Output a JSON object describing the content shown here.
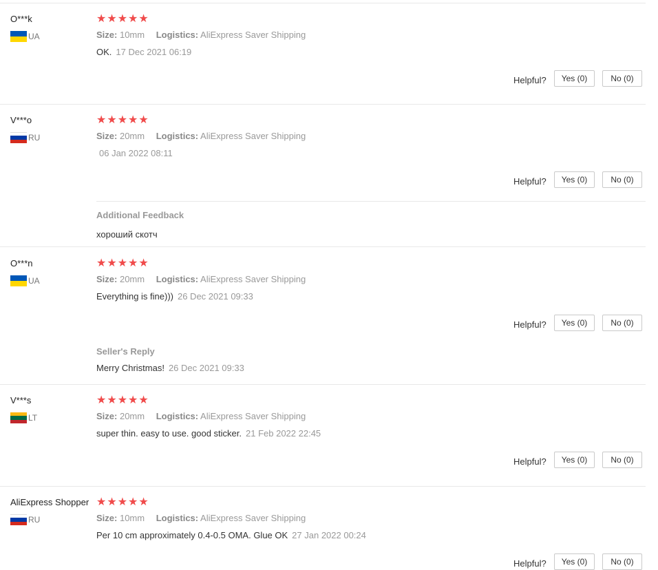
{
  "star_glyphs": "★★★★★",
  "size_key": "Size:",
  "logistics_key": "Logistics:",
  "helpful_label": "Helpful?",
  "reviews": [
    {
      "user": "O***k",
      "country": "UA",
      "rating": 5,
      "size": "10mm",
      "logistics": "AliExpress Saver Shipping",
      "text": "OK.",
      "date": "17 Dec 2021 06:19",
      "yes": "Yes (0)",
      "no": "No (0)"
    },
    {
      "user": "V***o",
      "country": "RU",
      "rating": 5,
      "size": "20mm",
      "logistics": "AliExpress Saver Shipping",
      "text": "",
      "date": "06 Jan 2022 08:11",
      "yes": "Yes (0)",
      "no": "No (0)",
      "additional_title": "Additional Feedback",
      "additional_text": "хороший скотч"
    },
    {
      "user": "O***n",
      "country": "UA",
      "rating": 5,
      "size": "20mm",
      "logistics": "AliExpress Saver Shipping",
      "text": "Everything is fine)))",
      "date": "26 Dec 2021 09:33",
      "yes": "Yes (0)",
      "no": "No (0)",
      "reply_title": "Seller's Reply",
      "reply_text": "Merry Christmas!",
      "reply_date": "26 Dec 2021 09:33"
    },
    {
      "user": "V***s",
      "country": "LT",
      "rating": 5,
      "size": "20mm",
      "logistics": "AliExpress Saver Shipping",
      "text": "super thin. easy to use. good sticker.",
      "date": "21 Feb 2022 22:45",
      "yes": "Yes (0)",
      "no": "No (0)"
    },
    {
      "user": "AliExpress Shopper",
      "country": "RU",
      "rating": 5,
      "size": "10mm",
      "logistics": "AliExpress Saver Shipping",
      "text": "Per 10 cm approximately 0.4-0.5 OMA. Glue OK",
      "date": "27 Jan 2022 00:24",
      "yes": "Yes (0)",
      "no": "No (0)"
    }
  ],
  "flag_colors": {
    "UA": [
      "#0057b7",
      "#ffd700"
    ],
    "RU": [
      "#ffffff",
      "#0039a6",
      "#d52b1e"
    ],
    "LT": [
      "#fdb913",
      "#006a44",
      "#c1272d"
    ]
  }
}
